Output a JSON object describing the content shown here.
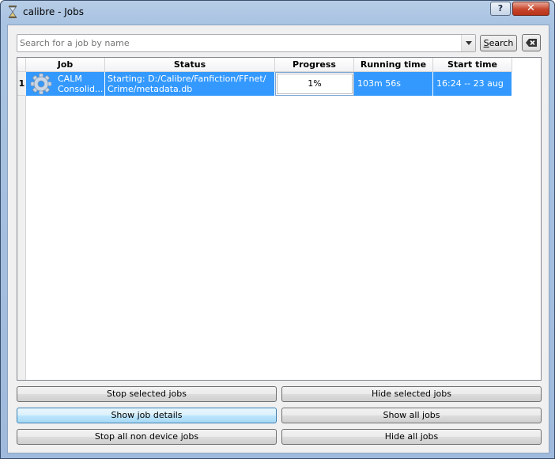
{
  "window": {
    "title": "calibre - Jobs",
    "help_label": "?",
    "close_label": "✕"
  },
  "search": {
    "placeholder": "Search for a job by name",
    "value": "",
    "button_label": "Search"
  },
  "table": {
    "columns": [
      "Job",
      "Status",
      "Progress",
      "Running time",
      "Start time"
    ],
    "rows": [
      {
        "row_number": "1",
        "job_line1": "CALM",
        "job_line2": "Consolid...",
        "status_line1": "Starting: D:/Calibre/Fanfiction/FFnet/",
        "status_line2": "Crime/metadata.db",
        "progress": "1%",
        "running_time": "103m 56s",
        "start_time": "16:24 -- 23 aug"
      }
    ]
  },
  "buttons": {
    "stop_selected": "Stop selected jobs",
    "hide_selected": "Hide selected jobs",
    "show_details": "Show job details",
    "show_all": "Show all jobs",
    "stop_all_non_device": "Stop all non device jobs",
    "hide_all": "Hide all jobs"
  },
  "colors": {
    "selection": "#3399ff",
    "window_frame": "#a9c3e2",
    "close_button": "#c7452c"
  },
  "icons": [
    "hourglass-icon",
    "gear-icon",
    "clear-search-icon",
    "dropdown-arrow-icon"
  ]
}
